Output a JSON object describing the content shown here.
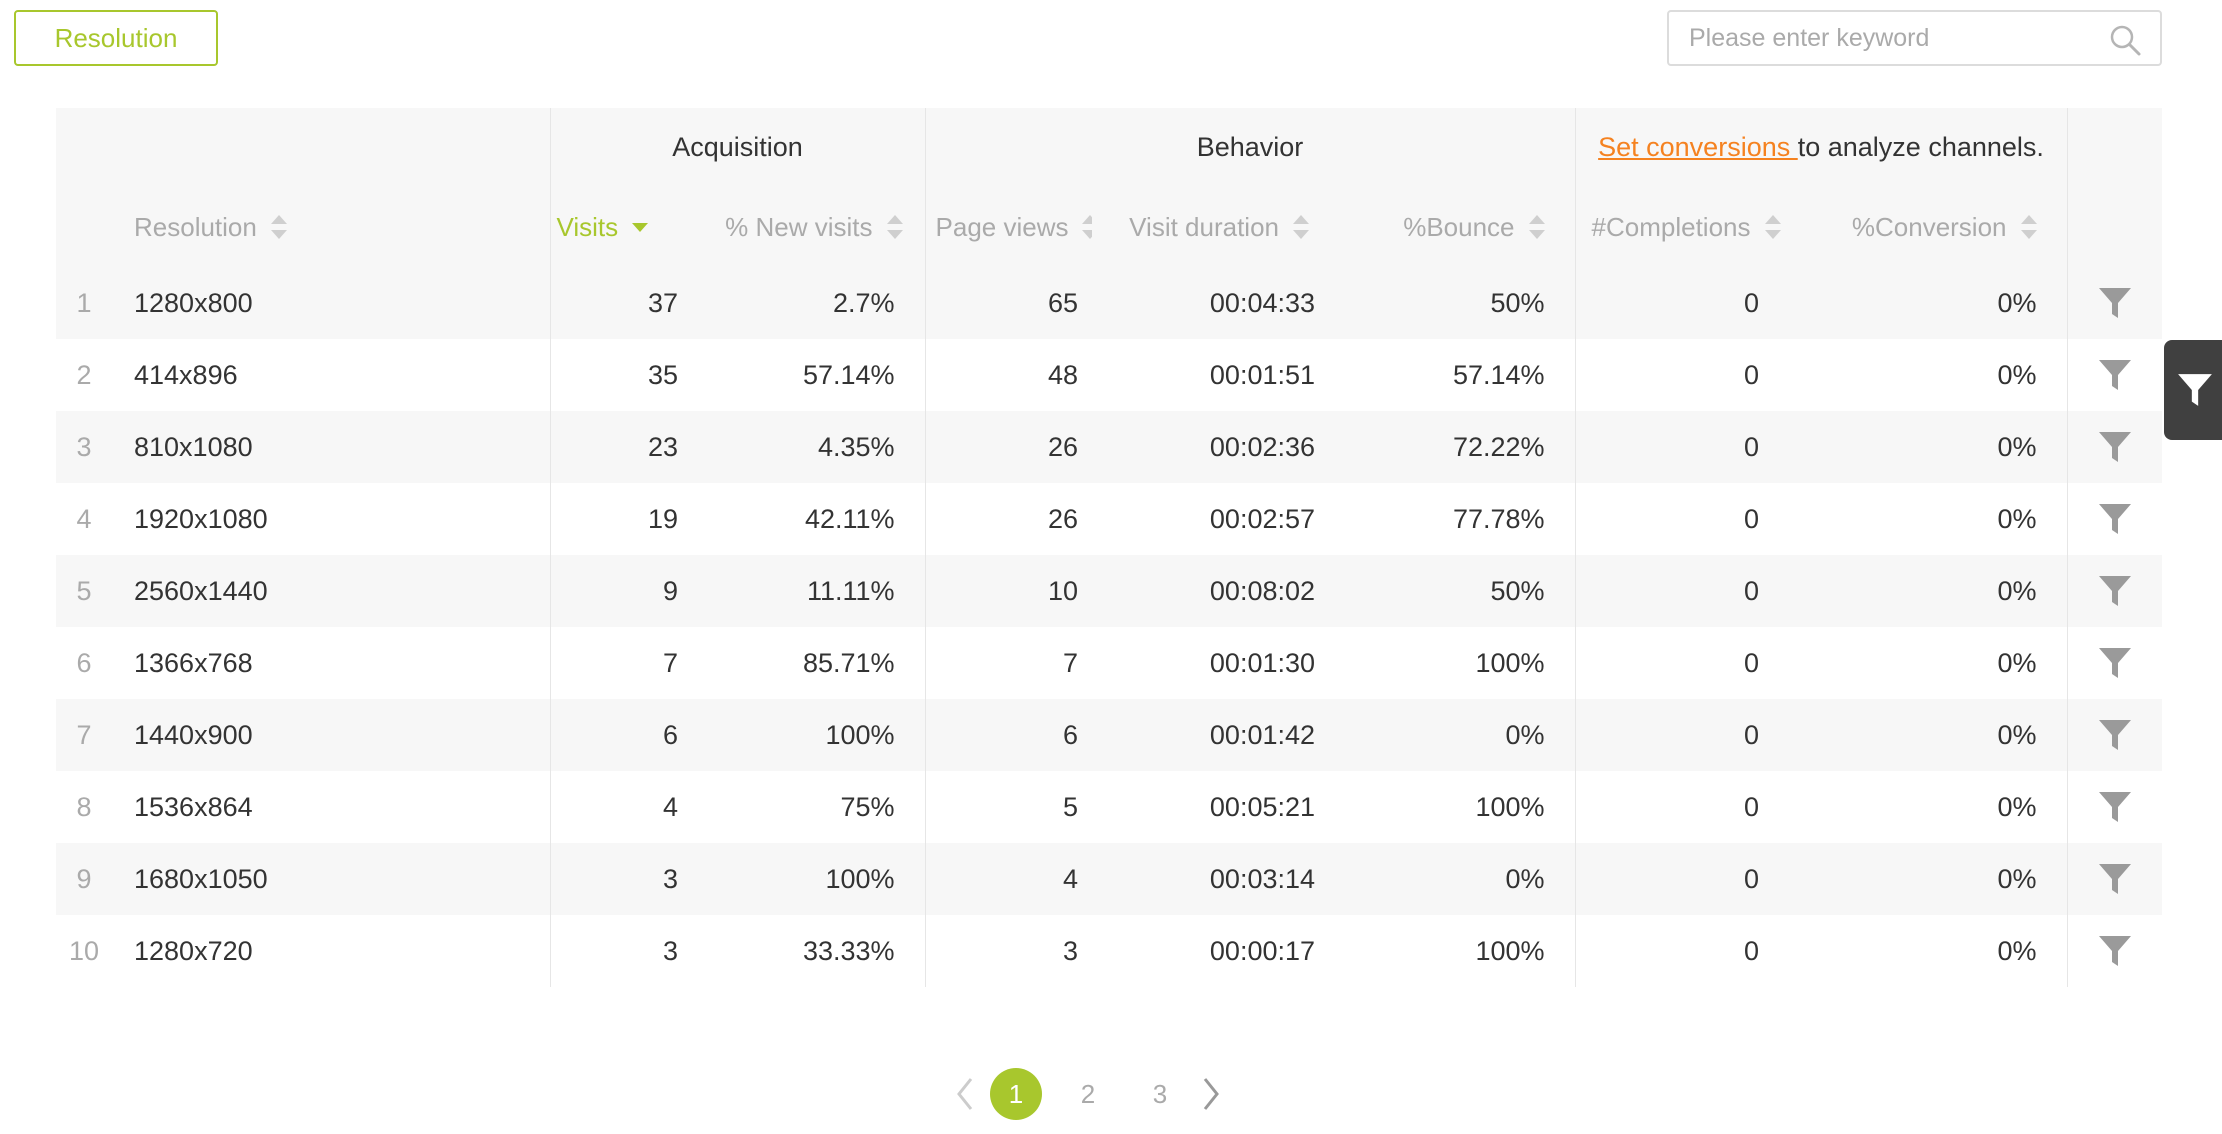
{
  "toolbar": {
    "dimension_label": "Resolution",
    "search_placeholder": "Please enter keyword"
  },
  "table": {
    "groups": {
      "acquisition": "Acquisition",
      "behavior": "Behavior",
      "conversion_link": "Set conversions ",
      "conversion_text": "to analyze channels."
    },
    "columns": {
      "resolution": "Resolution",
      "visits": "Visits",
      "new_visits": "% New visits",
      "page_views": "Page views",
      "visit_duration": "Visit duration",
      "bounce": "%Bounce",
      "completions": "#Completions",
      "conversion": "%Conversion"
    },
    "sorted_column": "visits",
    "sort_direction": "desc",
    "rows": [
      {
        "index": "1",
        "resolution": "1280x800",
        "visits": "37",
        "new_visits": "2.7%",
        "page_views": "65",
        "visit_duration": "00:04:33",
        "bounce": "50%",
        "completions": "0",
        "conversion": "0%"
      },
      {
        "index": "2",
        "resolution": "414x896",
        "visits": "35",
        "new_visits": "57.14%",
        "page_views": "48",
        "visit_duration": "00:01:51",
        "bounce": "57.14%",
        "completions": "0",
        "conversion": "0%"
      },
      {
        "index": "3",
        "resolution": "810x1080",
        "visits": "23",
        "new_visits": "4.35%",
        "page_views": "26",
        "visit_duration": "00:02:36",
        "bounce": "72.22%",
        "completions": "0",
        "conversion": "0%"
      },
      {
        "index": "4",
        "resolution": "1920x1080",
        "visits": "19",
        "new_visits": "42.11%",
        "page_views": "26",
        "visit_duration": "00:02:57",
        "bounce": "77.78%",
        "completions": "0",
        "conversion": "0%"
      },
      {
        "index": "5",
        "resolution": "2560x1440",
        "visits": "9",
        "new_visits": "11.11%",
        "page_views": "10",
        "visit_duration": "00:08:02",
        "bounce": "50%",
        "completions": "0",
        "conversion": "0%"
      },
      {
        "index": "6",
        "resolution": "1366x768",
        "visits": "7",
        "new_visits": "85.71%",
        "page_views": "7",
        "visit_duration": "00:01:30",
        "bounce": "100%",
        "completions": "0",
        "conversion": "0%"
      },
      {
        "index": "7",
        "resolution": "1440x900",
        "visits": "6",
        "new_visits": "100%",
        "page_views": "6",
        "visit_duration": "00:01:42",
        "bounce": "0%",
        "completions": "0",
        "conversion": "0%"
      },
      {
        "index": "8",
        "resolution": "1536x864",
        "visits": "4",
        "new_visits": "75%",
        "page_views": "5",
        "visit_duration": "00:05:21",
        "bounce": "100%",
        "completions": "0",
        "conversion": "0%"
      },
      {
        "index": "9",
        "resolution": "1680x1050",
        "visits": "3",
        "new_visits": "100%",
        "page_views": "4",
        "visit_duration": "00:03:14",
        "bounce": "0%",
        "completions": "0",
        "conversion": "0%"
      },
      {
        "index": "10",
        "resolution": "1280x720",
        "visits": "3",
        "new_visits": "33.33%",
        "page_views": "3",
        "visit_duration": "00:00:17",
        "bounce": "100%",
        "completions": "0",
        "conversion": "0%"
      }
    ]
  },
  "pagination": {
    "pages": [
      "1",
      "2",
      "3"
    ],
    "current": "1"
  },
  "icons": {
    "search": "search-icon",
    "funnel": "funnel-icon",
    "side_filter": "filter-icon",
    "prev": "chevron-left-icon",
    "next": "chevron-right-icon",
    "sort": "sort-icon"
  },
  "colors": {
    "accent": "#a8c72d",
    "link": "#f58220",
    "side_panel": "#404040"
  }
}
